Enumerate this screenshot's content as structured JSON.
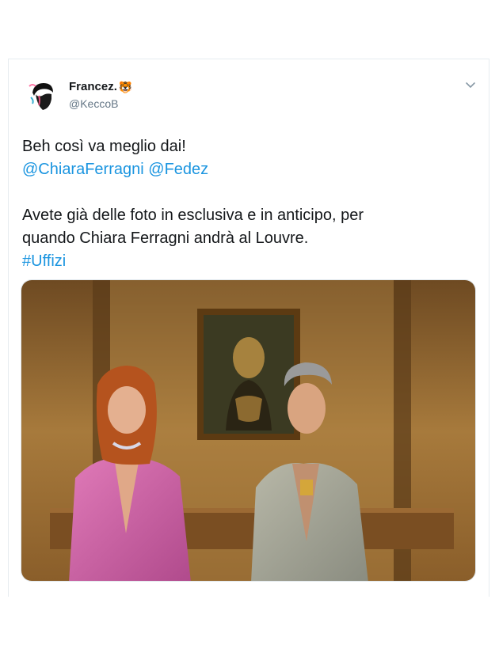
{
  "tweet": {
    "author": {
      "name": "Francez.",
      "name_emoji_icon": "tiger-face-icon",
      "handle": "@KeccoB"
    },
    "more_options_icon": "chevron-down-icon",
    "lines": {
      "line1": "Beh così va meglio dai!",
      "mention1": "@ChiaraFerragni",
      "mention2": "@Fedez",
      "line3a": "Avete già delle foto in esclusiva e in anticipo, per",
      "line3b": "quando Chiara Ferragni andrà al Louvre.",
      "hashtag": "#Uffizi"
    },
    "colors": {
      "link": "#1b95e0",
      "text": "#14171a",
      "secondary": "#657786"
    },
    "media_icon": "photo-collage-icon"
  }
}
